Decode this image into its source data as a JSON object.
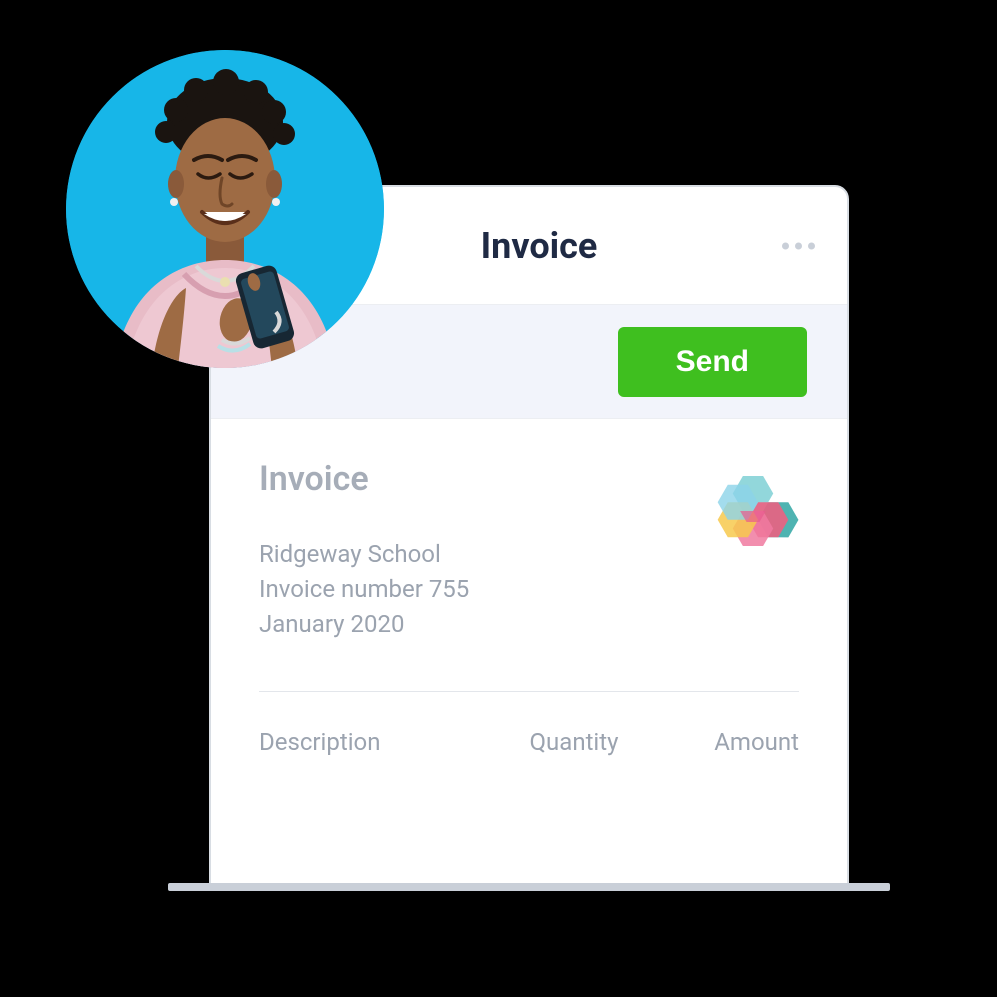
{
  "header": {
    "title": "Invoice"
  },
  "actions": {
    "send_label": "Send"
  },
  "document": {
    "title": "Invoice",
    "client": "Ridgeway School",
    "invoice_number": "Invoice number 755",
    "date": "January 2020"
  },
  "table": {
    "columns": {
      "description": "Description",
      "quantity": "Quantity",
      "amount": "Amount"
    }
  },
  "icons": {
    "more": "more-icon",
    "logo": "hex-logo-icon"
  },
  "colors": {
    "accent_green": "#3fbf1f",
    "avatar_bg": "#17b6e8",
    "text_dark": "#1f2a44",
    "text_muted": "#9ba3af"
  }
}
